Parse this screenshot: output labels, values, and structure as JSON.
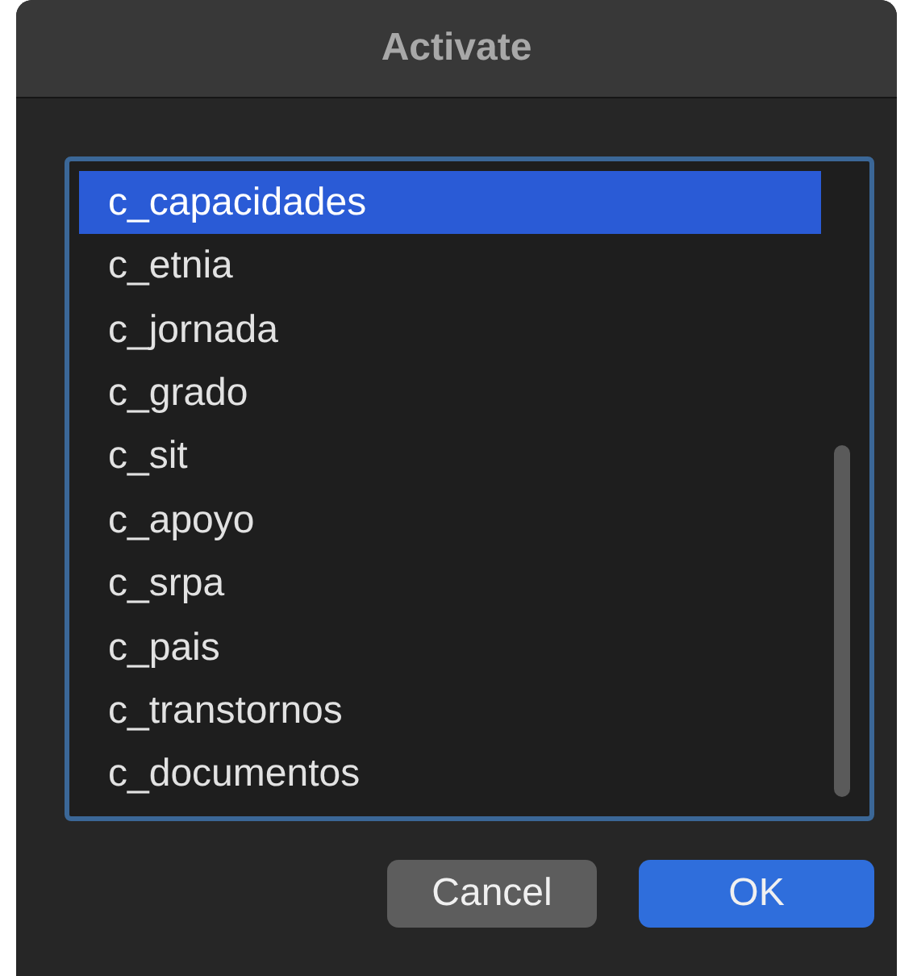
{
  "window": {
    "title": "Activate"
  },
  "list": {
    "items": [
      {
        "label": "c_capacidades",
        "selected": true
      },
      {
        "label": "c_etnia",
        "selected": false
      },
      {
        "label": "c_jornada",
        "selected": false
      },
      {
        "label": "c_grado",
        "selected": false
      },
      {
        "label": "c_sit",
        "selected": false
      },
      {
        "label": "c_apoyo",
        "selected": false
      },
      {
        "label": "c_srpa",
        "selected": false
      },
      {
        "label": "c_pais",
        "selected": false
      },
      {
        "label": "c_transtornos",
        "selected": false
      },
      {
        "label": "c_documentos",
        "selected": false
      }
    ]
  },
  "buttons": [
    {
      "label": "Cancel",
      "kind": "secondary"
    },
    {
      "label": "OK",
      "kind": "primary"
    }
  ]
}
